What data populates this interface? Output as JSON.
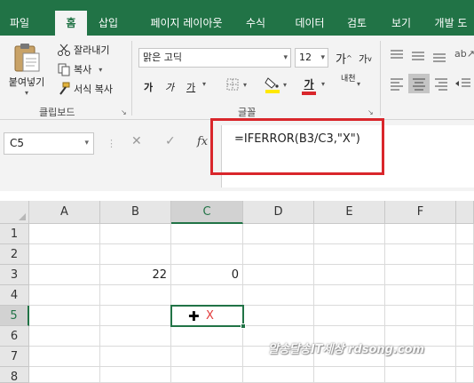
{
  "ribbon_tabs": {
    "file": "파일",
    "home": "홈",
    "insert": "삽입",
    "page_layout": "페이지 레이아웃",
    "formulas": "수식",
    "data": "데이터",
    "review": "검토",
    "view": "보기",
    "developer": "개발 도"
  },
  "clipboard": {
    "paste": "붙여넣기",
    "cut": "잘라내기",
    "copy": "복사",
    "format_painter": "서식 복사",
    "group_label": "클립보드"
  },
  "font": {
    "name": "맑은 고딕",
    "size": "12",
    "grow": "가",
    "shrink": "가",
    "bold": "가",
    "italic": "가",
    "underline": "가",
    "font_color": "가",
    "phonetic": "내천",
    "group_label": "글꼴"
  },
  "formula_bar": {
    "name_box": "C5",
    "cancel": "✕",
    "enter": "✓",
    "fx": "fx",
    "formula": "=IFERROR(B3/C3,\"X\")"
  },
  "grid": {
    "columns": [
      "A",
      "B",
      "C",
      "D",
      "E",
      "F"
    ],
    "rows": [
      "1",
      "2",
      "3",
      "4",
      "5",
      "6",
      "7",
      "8"
    ],
    "selected_column": "C",
    "selected_row": "5",
    "cells": {
      "B3": "22",
      "C3": "0",
      "C5": "X"
    }
  },
  "watermark": "알송달송IT세상 rdsong.com",
  "colors": {
    "excel_green": "#217346",
    "highlight_red": "#d9262b",
    "error_x": "#e23b3b",
    "font_color_bar": "#d9262b",
    "highlight_yellow": "#ffe800"
  }
}
